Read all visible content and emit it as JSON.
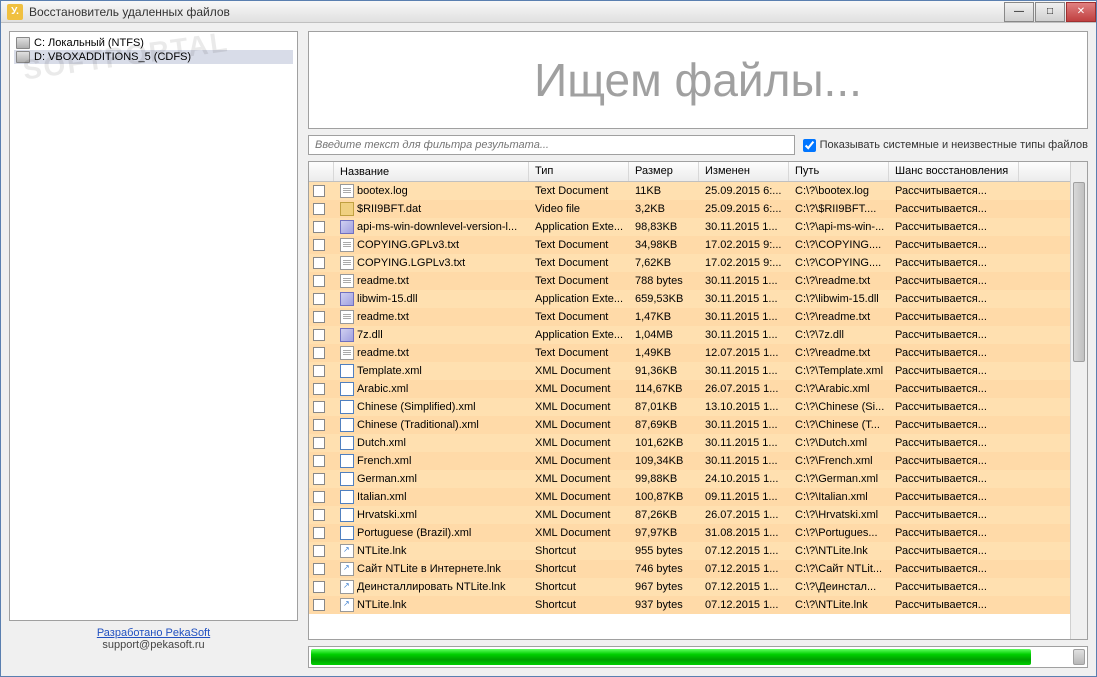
{
  "window": {
    "title": "Восстановитель удаленных файлов",
    "icon_letter": "У."
  },
  "drives": [
    {
      "label": "C: Локальный (NTFS)",
      "selected": false
    },
    {
      "label": "D: VBOXADDITIONS_5 (CDFS)",
      "selected": true
    }
  ],
  "footer": {
    "link_text": "Разработано PekaSoft",
    "email": "support@pekasoft.ru"
  },
  "banner_text": "Ищем файлы...",
  "filter": {
    "placeholder": "Введите текст для фильтра результата...",
    "checkbox_label": "Показывать системные и неизвестные типы файлов",
    "checked": true
  },
  "columns": {
    "name": "Название",
    "type": "Тип",
    "size": "Размер",
    "modified": "Изменен",
    "path": "Путь",
    "chance": "Шанс восстановления"
  },
  "recovery_calc": "Рассчитывается...",
  "files": [
    {
      "icon": "txt",
      "name": "bootex.log",
      "type": "Text Document",
      "size": "11KB",
      "modified": "25.09.2015 6:...",
      "path": "C:\\?\\bootex.log"
    },
    {
      "icon": "vid",
      "name": "$RII9BFT.dat",
      "type": "Video file",
      "size": "3,2KB",
      "modified": "25.09.2015 6:...",
      "path": "C:\\?\\$RII9BFT...."
    },
    {
      "icon": "dll",
      "name": "api-ms-win-downlevel-version-l...",
      "type": "Application Exte...",
      "size": "98,83KB",
      "modified": "30.11.2015 1...",
      "path": "C:\\?\\api-ms-win-..."
    },
    {
      "icon": "txt",
      "name": "COPYING.GPLv3.txt",
      "type": "Text Document",
      "size": "34,98KB",
      "modified": "17.02.2015 9:...",
      "path": "C:\\?\\COPYING...."
    },
    {
      "icon": "txt",
      "name": "COPYING.LGPLv3.txt",
      "type": "Text Document",
      "size": "7,62KB",
      "modified": "17.02.2015 9:...",
      "path": "C:\\?\\COPYING...."
    },
    {
      "icon": "txt",
      "name": "readme.txt",
      "type": "Text Document",
      "size": "788 bytes",
      "modified": "30.11.2015 1...",
      "path": "C:\\?\\readme.txt"
    },
    {
      "icon": "dll",
      "name": "libwim-15.dll",
      "type": "Application Exte...",
      "size": "659,53KB",
      "modified": "30.11.2015 1...",
      "path": "C:\\?\\libwim-15.dll"
    },
    {
      "icon": "txt",
      "name": "readme.txt",
      "type": "Text Document",
      "size": "1,47KB",
      "modified": "30.11.2015 1...",
      "path": "C:\\?\\readme.txt"
    },
    {
      "icon": "dll",
      "name": "7z.dll",
      "type": "Application Exte...",
      "size": "1,04MB",
      "modified": "30.11.2015 1...",
      "path": "C:\\?\\7z.dll"
    },
    {
      "icon": "txt",
      "name": "readme.txt",
      "type": "Text Document",
      "size": "1,49KB",
      "modified": "12.07.2015 1...",
      "path": "C:\\?\\readme.txt"
    },
    {
      "icon": "xml",
      "name": "Template.xml",
      "type": "XML Document",
      "size": "91,36KB",
      "modified": "30.11.2015 1...",
      "path": "C:\\?\\Template.xml"
    },
    {
      "icon": "xml",
      "name": "Arabic.xml",
      "type": "XML Document",
      "size": "114,67KB",
      "modified": "26.07.2015 1...",
      "path": "C:\\?\\Arabic.xml"
    },
    {
      "icon": "xml",
      "name": "Chinese (Simplified).xml",
      "type": "XML Document",
      "size": "87,01KB",
      "modified": "13.10.2015 1...",
      "path": "C:\\?\\Chinese (Si..."
    },
    {
      "icon": "xml",
      "name": "Chinese (Traditional).xml",
      "type": "XML Document",
      "size": "87,69KB",
      "modified": "30.11.2015 1...",
      "path": "C:\\?\\Chinese (T..."
    },
    {
      "icon": "xml",
      "name": "Dutch.xml",
      "type": "XML Document",
      "size": "101,62KB",
      "modified": "30.11.2015 1...",
      "path": "C:\\?\\Dutch.xml"
    },
    {
      "icon": "xml",
      "name": "French.xml",
      "type": "XML Document",
      "size": "109,34KB",
      "modified": "30.11.2015 1...",
      "path": "C:\\?\\French.xml"
    },
    {
      "icon": "xml",
      "name": "German.xml",
      "type": "XML Document",
      "size": "99,88KB",
      "modified": "24.10.2015 1...",
      "path": "C:\\?\\German.xml"
    },
    {
      "icon": "xml",
      "name": "Italian.xml",
      "type": "XML Document",
      "size": "100,87KB",
      "modified": "09.11.2015 1...",
      "path": "C:\\?\\Italian.xml"
    },
    {
      "icon": "xml",
      "name": "Hrvatski.xml",
      "type": "XML Document",
      "size": "87,26KB",
      "modified": "26.07.2015 1...",
      "path": "C:\\?\\Hrvatski.xml"
    },
    {
      "icon": "xml",
      "name": "Portuguese (Brazil).xml",
      "type": "XML Document",
      "size": "97,97KB",
      "modified": "31.08.2015 1...",
      "path": "C:\\?\\Portugues..."
    },
    {
      "icon": "lnk",
      "name": "NTLite.lnk",
      "type": "Shortcut",
      "size": "955 bytes",
      "modified": "07.12.2015 1...",
      "path": "C:\\?\\NTLite.lnk"
    },
    {
      "icon": "lnk",
      "name": "Сайт NTLite в Интернете.lnk",
      "type": "Shortcut",
      "size": "746 bytes",
      "modified": "07.12.2015 1...",
      "path": "C:\\?\\Сайт NTLit..."
    },
    {
      "icon": "lnk",
      "name": "Деинсталлировать NTLite.lnk",
      "type": "Shortcut",
      "size": "967 bytes",
      "modified": "07.12.2015 1...",
      "path": "C:\\?\\Деинстал..."
    },
    {
      "icon": "lnk",
      "name": "NTLite.lnk",
      "type": "Shortcut",
      "size": "937 bytes",
      "modified": "07.12.2015 1...",
      "path": "C:\\?\\NTLite.lnk"
    }
  ],
  "watermark": "SOFTPORTAL"
}
